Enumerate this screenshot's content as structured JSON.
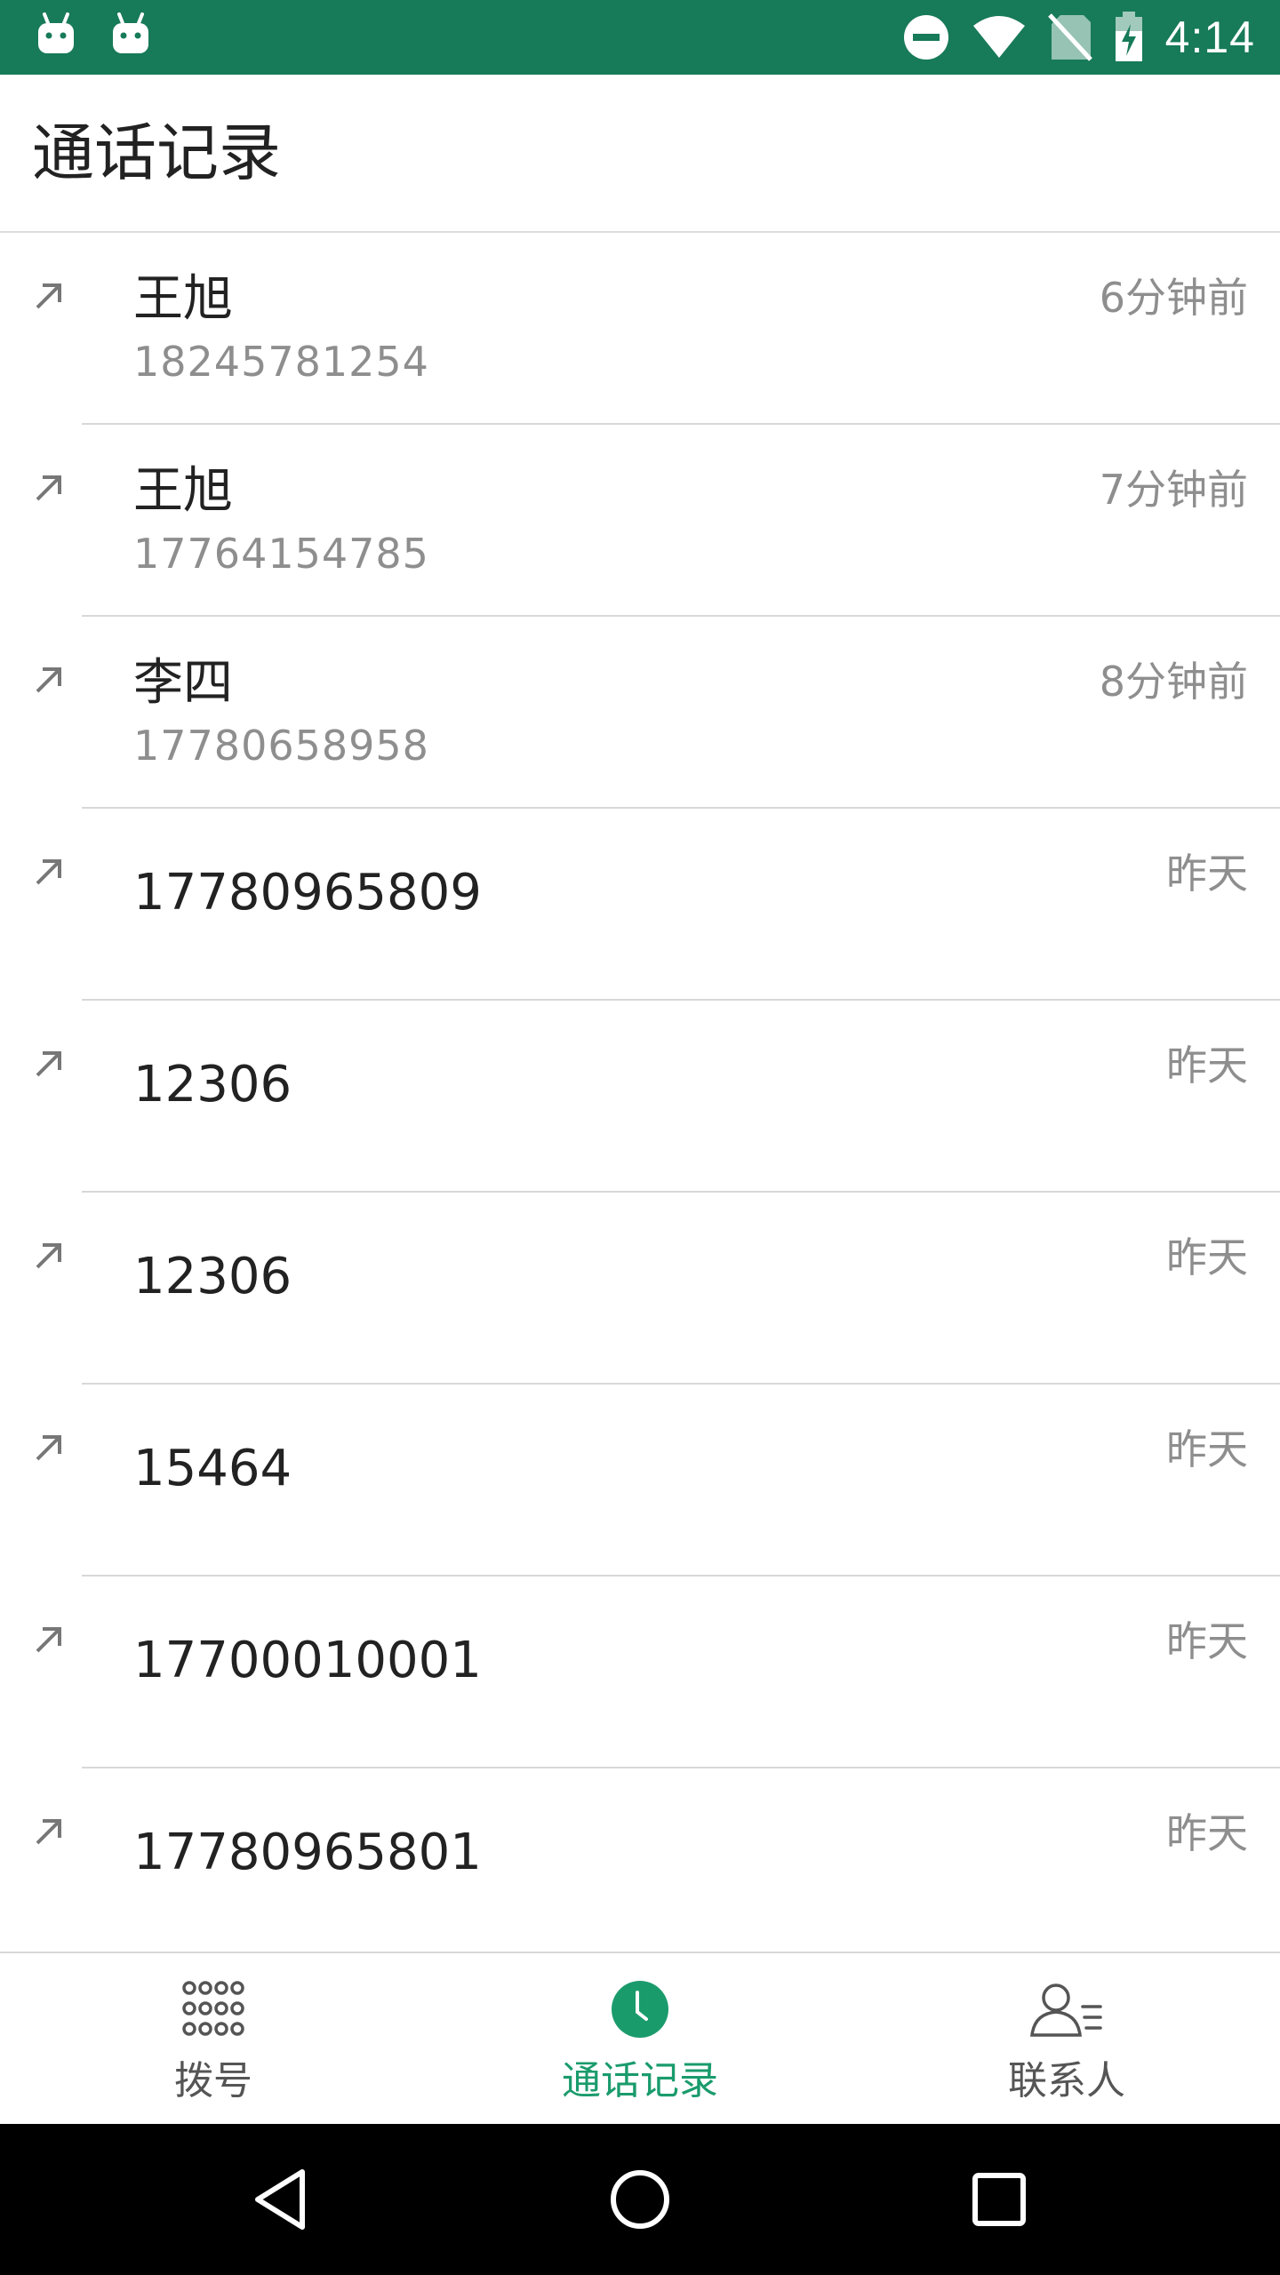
{
  "status_bar": {
    "time": "4:14",
    "background": "#177a58",
    "icons": [
      "android-icon",
      "android-icon",
      "do-not-disturb-icon",
      "wifi-icon",
      "no-sim-icon",
      "battery-charging-icon"
    ]
  },
  "header": {
    "title": "通话记录"
  },
  "calls": [
    {
      "name": "王旭",
      "number": "18245781254",
      "time": "6分钟前",
      "direction": "outgoing"
    },
    {
      "name": "王旭",
      "number": "17764154785",
      "time": "7分钟前",
      "direction": "outgoing"
    },
    {
      "name": "李四",
      "number": "17780658958",
      "time": "8分钟前",
      "direction": "outgoing"
    },
    {
      "name": "17780965809",
      "number": "",
      "time": "昨天",
      "direction": "outgoing"
    },
    {
      "name": "12306",
      "number": "",
      "time": "昨天",
      "direction": "outgoing"
    },
    {
      "name": "12306",
      "number": "",
      "time": "昨天",
      "direction": "outgoing"
    },
    {
      "name": "15464",
      "number": "",
      "time": "昨天",
      "direction": "outgoing"
    },
    {
      "name": "17700010001",
      "number": "",
      "time": "昨天",
      "direction": "outgoing"
    },
    {
      "name": "17780965801",
      "number": "",
      "time": "昨天",
      "direction": "outgoing"
    }
  ],
  "tabs": [
    {
      "label": "拨号",
      "icon": "dialpad-icon",
      "active": false
    },
    {
      "label": "通话记录",
      "icon": "clock-icon",
      "active": true
    },
    {
      "label": "联系人",
      "icon": "contacts-icon",
      "active": false
    }
  ],
  "colors": {
    "accent": "#1a9b6c",
    "status_bar": "#177a58"
  },
  "nav_bar": {
    "buttons": [
      "back-icon",
      "home-icon",
      "recents-icon"
    ]
  }
}
